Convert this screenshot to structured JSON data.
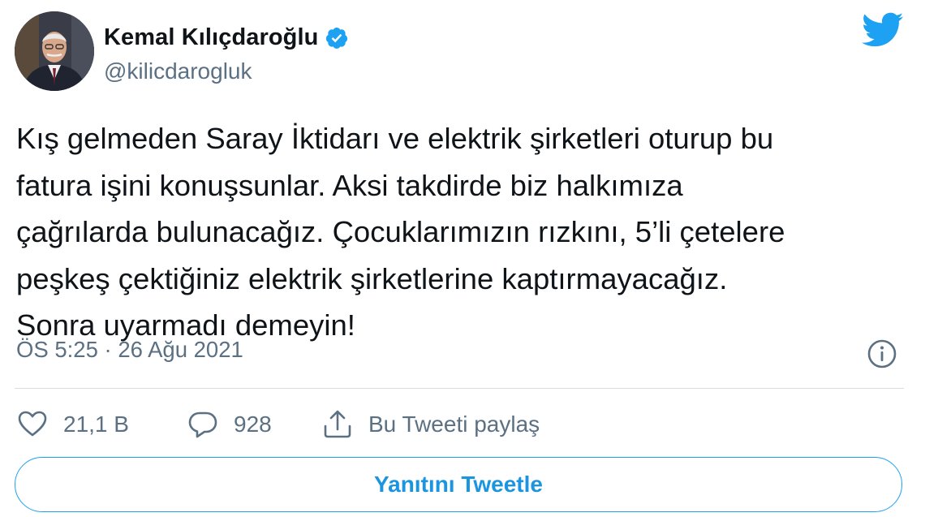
{
  "author": {
    "display_name": "Kemal Kılıçdaroğlu",
    "handle": "@kilicdarogluk",
    "verified": true
  },
  "tweet": {
    "lines": [
      "Kış gelmeden Saray İktidarı ve elektrik şirketleri oturup bu",
      "fatura işini konuşsunlar. Aksi takdirde biz halkımıza",
      "çağrılarda bulunacağız. Çocuklarımızın rızkını, 5’li çetelere",
      "peşkeş çektiğiniz elektrik şirketlerine kaptırmayacağız.",
      "Sonra uyarmadı demeyin!"
    ],
    "time": "ÖS 5:25",
    "separator": "·",
    "date": "26 Ağu 2021"
  },
  "actions": {
    "likes": "21,1 B",
    "replies": "928",
    "share_label": "Bu Tweeti paylaş"
  },
  "reply_button": {
    "label": "Yanıtını Tweetle"
  },
  "icons": {
    "brand": "twitter-bird-icon",
    "verified": "verified-badge-icon",
    "info": "info-icon",
    "like": "heart-icon",
    "reply": "speech-bubble-icon",
    "share": "share-icon"
  },
  "colors": {
    "brand": "#1da1f2",
    "text": "#0f1419",
    "secondary": "#5b7083",
    "divider": "#d9dde1"
  }
}
